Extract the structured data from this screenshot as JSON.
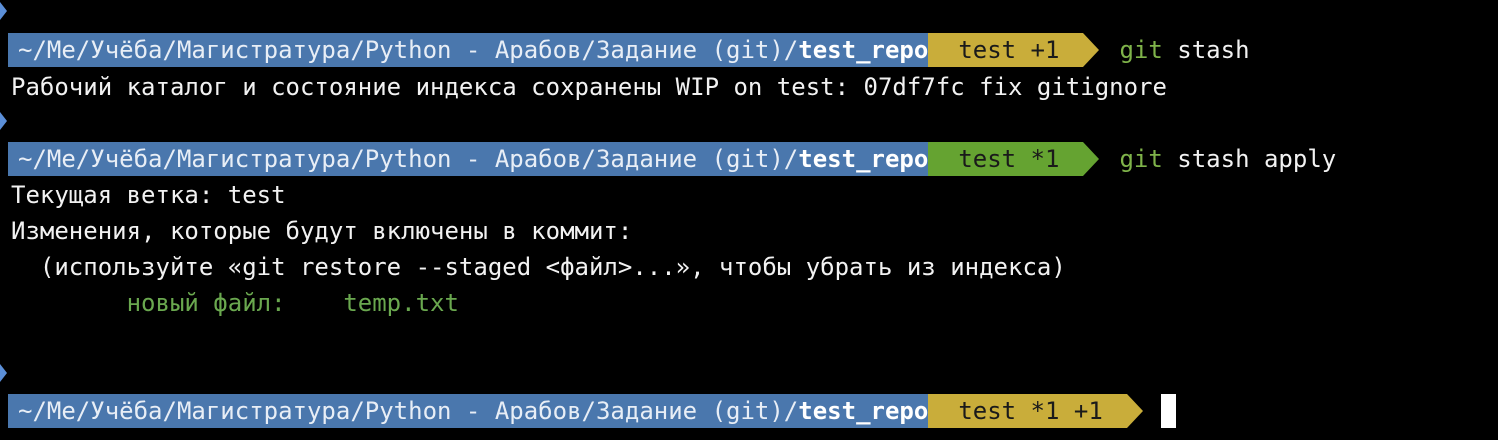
{
  "prompts": [
    {
      "path_dir": "~/Me/Учёба/Магистратура/Python - Арабов/Задание (git)/",
      "path_repo": "test_repo",
      "git_status": "test +1",
      "git_color": "#c9ad3a",
      "command_keyword": "git",
      "command_args": " stash"
    },
    {
      "path_dir": "~/Me/Учёба/Магистратура/Python - Арабов/Задание (git)/",
      "path_repo": "test_repo",
      "git_status": "test *1",
      "git_color": "#65a331",
      "command_keyword": "git",
      "command_args": " stash apply"
    },
    {
      "path_dir": "~/Me/Учёба/Магистратура/Python - Арабов/Задание (git)/",
      "path_repo": "test_repo",
      "git_status": "test *1 +1",
      "git_color": "#c9ad3a",
      "command_keyword": "",
      "command_args": ""
    }
  ],
  "output": {
    "stash_result": "Рабочий каталог и состояние индекса сохранены WIP on test: 07df7fc fix gitignore",
    "branch_line": "Текущая ветка: test",
    "changes_header": "Изменения, которые будут включены в коммит:",
    "changes_hint": "  (используйте «git restore --staged <файл>...», чтобы убрать из индекса)",
    "staged_file": "        новый файл:    temp.txt"
  },
  "colors": {
    "background": "#000000",
    "path_segment": "#4a77ad",
    "git_clean_ahead": "#c9ad3a",
    "git_dirty": "#65a331",
    "marker": "#5b8fd8",
    "staged_text": "#6aa84f"
  }
}
